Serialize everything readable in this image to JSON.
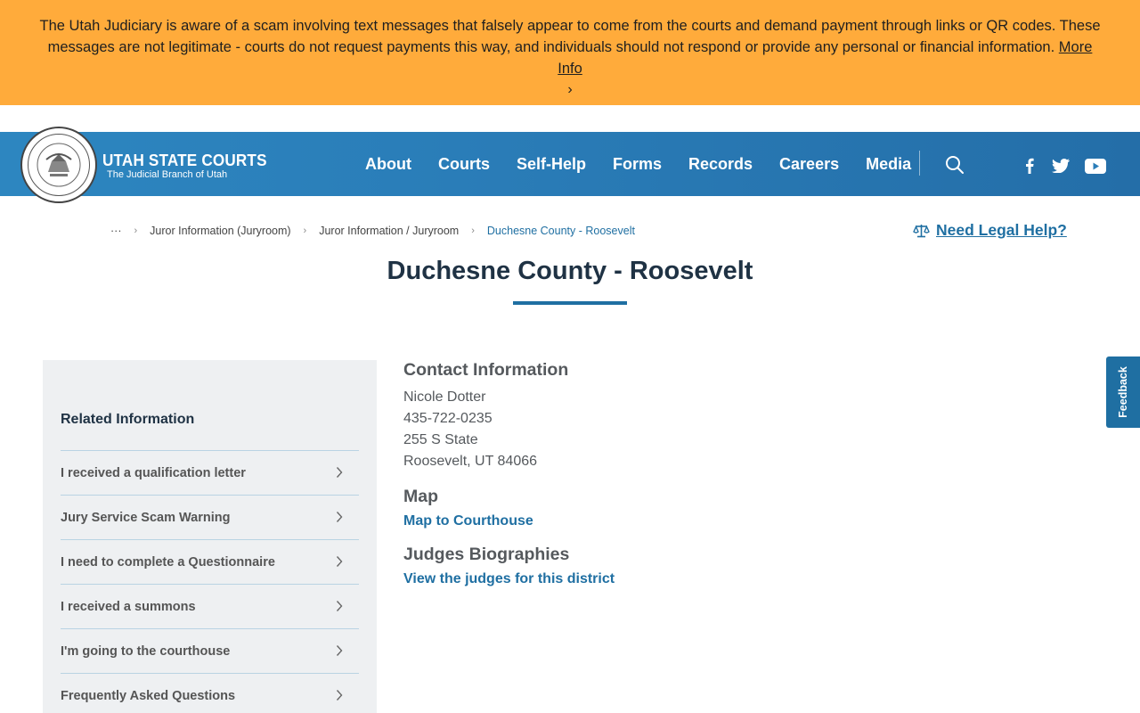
{
  "alert": {
    "message": "The Utah Judiciary is aware of a scam involving text messages that falsely appear to come from the courts and demand payment through links or QR codes. These messages are not legitimate - courts do not request payments this way, and individuals should not respond or provide any personal or financial information.",
    "more_info": "More Info",
    "chevron": "›",
    "bg_color": "#ffab3b"
  },
  "header": {
    "brand_name": "UTAH STATE COURTS",
    "brand_sub": "The Judicial Branch of Utah",
    "nav": [
      "About",
      "Courts",
      "Self-Help",
      "Forms",
      "Records",
      "Careers",
      "Media"
    ],
    "icons": [
      "search-icon",
      "facebook-icon",
      "twitter-icon",
      "youtube-icon"
    ],
    "accent_color": "#2a7db8"
  },
  "breadcrumb": {
    "ellipsis": "···",
    "items": [
      "Juror Information (Juryroom)",
      "Juror Information / Juryroom"
    ],
    "current": "Duchesne County - Roosevelt"
  },
  "legal_help": "Need Legal Help?",
  "page_title": "Duchesne County - Roosevelt",
  "sidebar": {
    "heading": "Related Information",
    "items": [
      "I received a qualification letter",
      "Jury Service Scam Warning",
      "I need to complete a Questionnaire",
      "I received a summons",
      "I'm going to the courthouse",
      "Frequently Asked Questions"
    ]
  },
  "contact": {
    "heading": "Contact Information",
    "name": "Nicole Dotter",
    "phone": "435-722-0235",
    "street": "255 S State",
    "city": "Roosevelt, UT 84066"
  },
  "map": {
    "heading": "Map",
    "link": "Map to Courthouse"
  },
  "judges": {
    "heading": "Judges Biographies",
    "link": "View the judges for this district"
  },
  "feedback": "Feedback"
}
